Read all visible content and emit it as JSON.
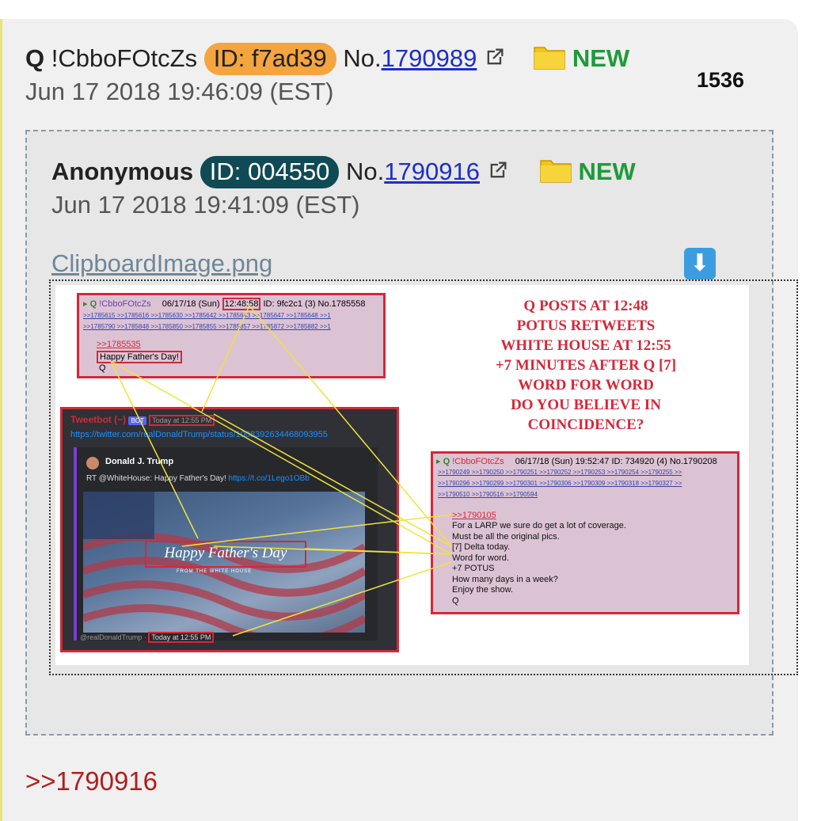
{
  "post": {
    "name": "Q",
    "tripcode": "!CbboFOtcZs",
    "id_label": "ID: f7ad39",
    "no_prefix": "No.",
    "no": "1790989",
    "new_label": "NEW",
    "date": "Jun 17 2018 19:46:09 (EST)",
    "reply_count": "1536",
    "reply_link": ">>1790916"
  },
  "quoted": {
    "name": "Anonymous",
    "id_label": "ID: 004550",
    "no_prefix": "No.",
    "no": "1790916",
    "new_label": "NEW",
    "date": "Jun 17 2018 19:41:09 (EST)",
    "filename": "ClipboardImage.png"
  },
  "image": {
    "headline": [
      "Q POSTS AT 12:48",
      "POTUS RETWEETS",
      "WHITE HOUSE AT 12:55",
      "+7 MINUTES AFTER Q [7]",
      "WORD FOR WORD",
      "DO YOU BELIEVE IN",
      "COINCIDENCE?"
    ],
    "p1": {
      "trip": "!CbboFOtcZs",
      "date": "06/17/18 (Sun)",
      "time": "12:48:58",
      "idno": "ID: 9fc2c1 (3) No.1785558",
      "links1": ">>1785615  >>1785616  >>1785630  >>1785642  >>1785643  >>1785647  >>1785648  >>1",
      "links2": ">>1785790  >>1785848  >>1785850  >>1785855  >>1785857  >>1785872  >>1785882  >>1",
      "ref": ">>1785535",
      "msg": "Happy Father's Day!",
      "sig": "Q"
    },
    "tweet": {
      "app": "Tweetbot (~)",
      "bot": "BOT",
      "time": "Today at 12:55 PM",
      "url": "https://twitter.com/realDonaldTrump/status/1008392634468093955",
      "author": "Donald J. Trump",
      "rt_text": "RT @WhiteHouse: Happy Father's Day!",
      "rt_link": "https://t.co/1Lego1OBb",
      "banner": "Happy Father's Day",
      "banner_sub": "FROM THE WHITE HOUSE",
      "footer_user": "@realDonaldTrump",
      "footer_time": "Today at 12:55 PM"
    },
    "p2": {
      "trip": "!CbboFOtcZs",
      "meta": "06/17/18 (Sun) 19:52:47 ID: 734920 (4) No.1790208",
      "links1": ">>1790249  >>1790250  >>1790251  >>1790252  >>1790253  >>1790254  >>1790255  >>",
      "links2": ">>1790296  >>1790299  >>1790301  >>1790306  >>1790309  >>1790318  >>1790327  >>",
      "links3": ">>1790510  >>1790516  >>1790594",
      "ref": ">>1790105",
      "lines": [
        "For a LARP we sure do get a lot of coverage.",
        "Must be all the original pics.",
        "[7] Delta today.",
        "Word for word.",
        "+7 POTUS",
        "How many days in a week?",
        "Enjoy the show.",
        "Q"
      ]
    }
  },
  "colors": {
    "id_q_bg": "#f5a53f",
    "id_anon_bg": "#0f4a55",
    "new_green": "#1f9a3a",
    "link_blue": "#1d2fc6",
    "reply_red": "#b11e1e",
    "annotation_red": "#d4283a",
    "arrow_yellow": "#f2e23a"
  },
  "icons": [
    "external-link-icon",
    "folder-icon",
    "download-icon"
  ]
}
